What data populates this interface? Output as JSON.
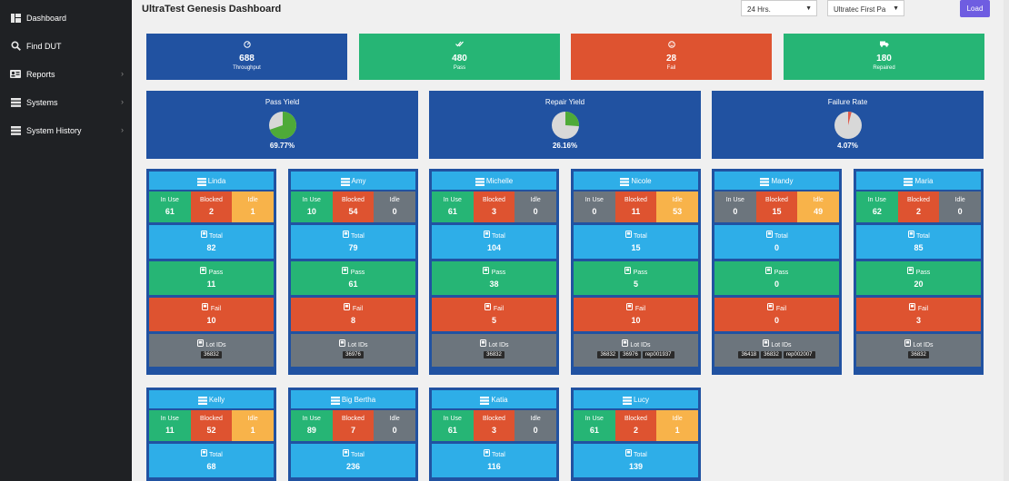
{
  "sidebar": {
    "items": [
      {
        "label": "Dashboard",
        "icon": "dashboard-icon",
        "arrow": false
      },
      {
        "label": "Find DUT",
        "icon": "search-icon",
        "arrow": false
      },
      {
        "label": "Reports",
        "icon": "reports-icon",
        "arrow": true
      },
      {
        "label": "Systems",
        "icon": "systems-icon",
        "arrow": true
      },
      {
        "label": "System History",
        "icon": "history-icon",
        "arrow": true
      }
    ]
  },
  "header": {
    "title": "UltraTest Genesis Dashboard",
    "time_select": "24 Hrs.",
    "pass_select": "Ultratec First Pa",
    "load_label": "Load"
  },
  "summary": [
    {
      "label": "Throughput",
      "value": "688",
      "color": "#2152a1",
      "icon": "dashboard-gauge-icon"
    },
    {
      "label": "Pass",
      "value": "480",
      "color": "#26b575",
      "icon": "double-check-icon"
    },
    {
      "label": "Fail",
      "value": "28",
      "color": "#de5330",
      "icon": "frown-icon"
    },
    {
      "label": "Repaired",
      "value": "180",
      "color": "#26b575",
      "icon": "truck-icon"
    }
  ],
  "yields": [
    {
      "title": "Pass Yield",
      "percent": "69.77%",
      "fraction": 0.6977
    },
    {
      "title": "Repair Yield",
      "percent": "26.16%",
      "fraction": 0.2616
    },
    {
      "title": "Failure Rate",
      "percent": "4.07%",
      "fraction": 0.0407
    }
  ],
  "labels": {
    "in_use": "In Use",
    "blocked": "Blocked",
    "idle": "Idle",
    "total": "Total",
    "pass": "Pass",
    "fail": "Fail",
    "lot_ids": "Lot IDs"
  },
  "people": [
    {
      "name": "Linda",
      "in_use": "61",
      "blocked": "2",
      "idle": "1",
      "idle_alert": true,
      "total": "82",
      "pass": "11",
      "fail": "10",
      "lots": [
        "36832"
      ]
    },
    {
      "name": "Amy",
      "in_use": "10",
      "blocked": "54",
      "idle": "0",
      "idle_alert": false,
      "total": "79",
      "pass": "61",
      "fail": "8",
      "lots": [
        "36976"
      ]
    },
    {
      "name": "Michelle",
      "in_use": "61",
      "blocked": "3",
      "idle": "0",
      "idle_alert": false,
      "total": "104",
      "pass": "38",
      "fail": "5",
      "lots": [
        "36832"
      ]
    },
    {
      "name": "Nicole",
      "in_use": "0",
      "blocked": "11",
      "idle": "53",
      "idle_alert": true,
      "in_use_alert": true,
      "total": "15",
      "pass": "5",
      "fail": "10",
      "lots": [
        "36832",
        "36976",
        "rep001937"
      ]
    },
    {
      "name": "Mandy",
      "in_use": "0",
      "blocked": "15",
      "idle": "49",
      "idle_alert": true,
      "in_use_alert": true,
      "total": "0",
      "pass": "0",
      "fail": "0",
      "lots": [
        "36418",
        "36832",
        "rep002007"
      ]
    },
    {
      "name": "Maria",
      "in_use": "62",
      "blocked": "2",
      "idle": "0",
      "idle_alert": false,
      "total": "85",
      "pass": "20",
      "fail": "3",
      "lots": [
        "36832"
      ]
    },
    {
      "name": "Kelly",
      "in_use": "11",
      "blocked": "52",
      "idle": "1",
      "idle_alert": true,
      "total": "68"
    },
    {
      "name": "Big Bertha",
      "in_use": "89",
      "blocked": "7",
      "idle": "0",
      "idle_alert": false,
      "total": "236"
    },
    {
      "name": "Katia",
      "in_use": "61",
      "blocked": "3",
      "idle": "0",
      "idle_alert": false,
      "total": "116"
    },
    {
      "name": "Lucy",
      "in_use": "61",
      "blocked": "2",
      "idle": "1",
      "idle_alert": true,
      "total": "139"
    }
  ]
}
